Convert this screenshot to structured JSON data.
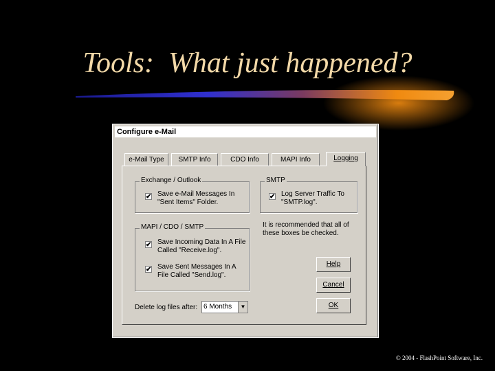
{
  "slide": {
    "title": "Tools:  What just happened?",
    "footer": "© 2004 - FlashPoint Software, Inc."
  },
  "dialog": {
    "title": "Configure e-Mail",
    "tabs": [
      "e-Mail Type",
      "SMTP Info",
      "CDO Info",
      "MAPI Info",
      "Logging"
    ],
    "active_tab": "Logging",
    "groups": {
      "exchange": {
        "label": "Exchange / Outlook",
        "items": [
          {
            "text": "Save e-Mail Messages In \"Sent Items\" Folder.",
            "checked": "✔"
          }
        ]
      },
      "smtp": {
        "label": "SMTP",
        "items": [
          {
            "text": "Log Server Traffic To \"SMTP.log\".",
            "checked": "✔"
          }
        ]
      },
      "mapi": {
        "label": "MAPI / CDO / SMTP",
        "items": [
          {
            "text": "Save Incoming Data In A File Called \"Receive.log\".",
            "checked": "✔"
          },
          {
            "text": "Save Sent Messages In A File Called \"Send.log\".",
            "checked": "✔"
          }
        ]
      }
    },
    "note": "It is recommended that all of these boxes be checked.",
    "buttons": {
      "help": "Help",
      "cancel": "Cancel",
      "ok": "OK"
    },
    "delete_label": "Delete log files after:",
    "delete_value": "6 Months"
  },
  "colors": {
    "title_text": "#f3d9a8",
    "swoosh_orange": "#f08a10",
    "swoosh_blue": "#2020c0",
    "dialog_face": "#d4d0c8"
  }
}
